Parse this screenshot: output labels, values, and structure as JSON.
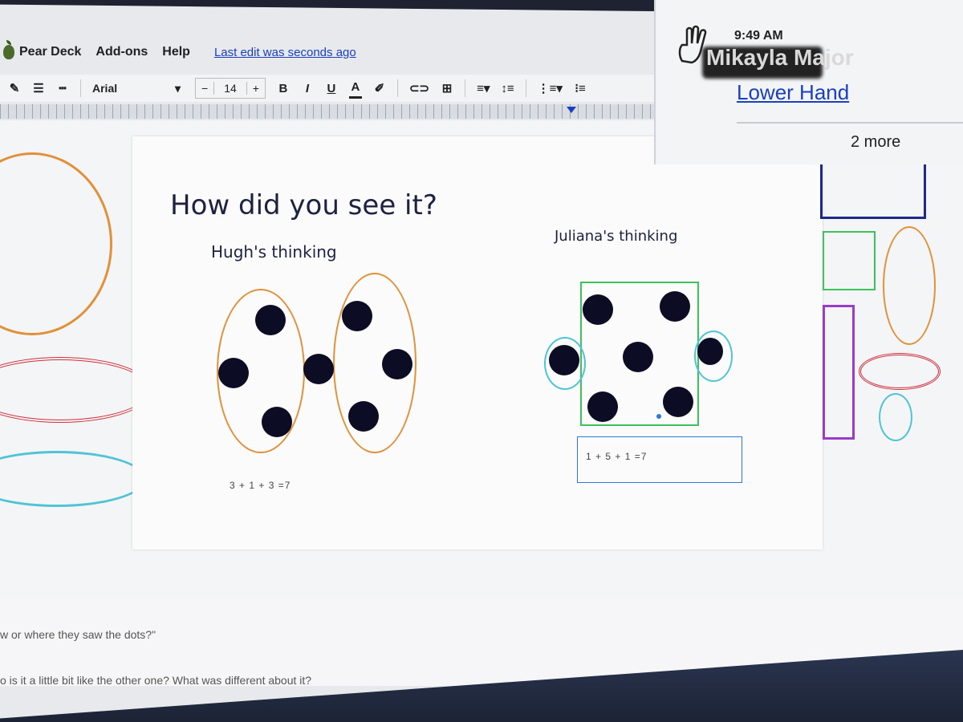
{
  "menu": {
    "pear_deck": "Pear Deck",
    "addons": "Add-ons",
    "help": "Help",
    "last_edit": "Last edit was seconds ago"
  },
  "toolbar": {
    "font": "Arial",
    "font_size": "14",
    "minus": "−",
    "plus": "+",
    "bold": "B",
    "italic": "I",
    "underline": "U",
    "text_color": "A"
  },
  "slide": {
    "title": "How did you see it?",
    "hugh_caption": "Hugh's thinking",
    "juliana_caption": "Juliana's thinking",
    "hugh_equation": "3 + 1 + 3 =7",
    "juliana_equation": "1 + 5 + 1 =7"
  },
  "panel": {
    "time": "9:49 AM",
    "name": "Mikayla Major",
    "lower_hand": "Lower Hand",
    "more": "2 more"
  },
  "notes": {
    "line1": "w or where they saw the dots?\"",
    "line2": "o is it a little bit like the other one? What was different about it?"
  },
  "colors": {
    "orange": "#e0913a",
    "red": "#cf2f3a",
    "teal": "#4fc4d6",
    "green": "#3cc45a",
    "purple": "#9a3cc9",
    "navy": "#1d2a8a",
    "link_blue": "#1a3fbf"
  }
}
